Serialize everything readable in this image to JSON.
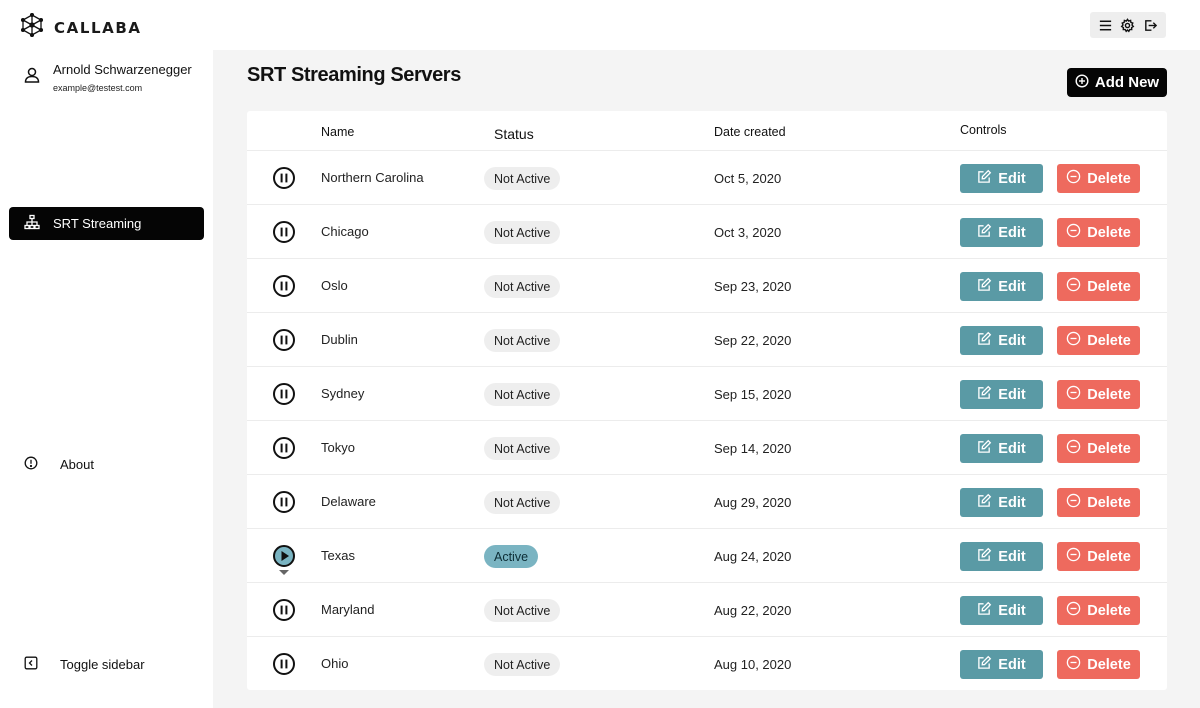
{
  "app": {
    "name": "CALLABA",
    "top_icons": [
      "menu-icon",
      "gear-icon",
      "logout-icon"
    ]
  },
  "sidebar": {
    "user_name": "Arnold Schwarzenegger",
    "user_email": "example@testest.com",
    "active_item": "SRT Streaming",
    "about_label": "About",
    "toggle_label": "Toggle sidebar"
  },
  "main": {
    "title": "SRT Streaming Servers",
    "add_new_label": "Add New",
    "columns": {
      "name": "Name",
      "status": "Status",
      "date": "Date created",
      "controls": "Controls"
    },
    "edit_label": "Edit",
    "delete_label": "Delete",
    "rows": [
      {
        "name": "Northern Carolina",
        "status": "Not Active",
        "date": "Oct 5, 2020",
        "playing": false
      },
      {
        "name": "Chicago",
        "status": "Not Active",
        "date": "Oct 3, 2020",
        "playing": false
      },
      {
        "name": "Oslo",
        "status": "Not Active",
        "date": "Sep 23, 2020",
        "playing": false
      },
      {
        "name": "Dublin",
        "status": "Not Active",
        "date": "Sep 22, 2020",
        "playing": false
      },
      {
        "name": "Sydney",
        "status": "Not Active",
        "date": "Sep 15, 2020",
        "playing": false
      },
      {
        "name": "Tokyo",
        "status": "Not Active",
        "date": "Sep 14, 2020",
        "playing": false
      },
      {
        "name": "Delaware",
        "status": "Not Active",
        "date": "Aug 29, 2020",
        "playing": false
      },
      {
        "name": "Texas",
        "status": "Active",
        "date": "Aug 24, 2020",
        "playing": true
      },
      {
        "name": "Maryland",
        "status": "Not Active",
        "date": "Aug 22, 2020",
        "playing": false
      },
      {
        "name": "Ohio",
        "status": "Not Active",
        "date": "Aug 10, 2020",
        "playing": false
      }
    ]
  },
  "colors": {
    "edit": "#5a9aa5",
    "delete": "#ee6a5e",
    "active_badge": "#7ab4c2",
    "inactive_badge": "#eeeeee",
    "sidebar_active": "#050505"
  }
}
